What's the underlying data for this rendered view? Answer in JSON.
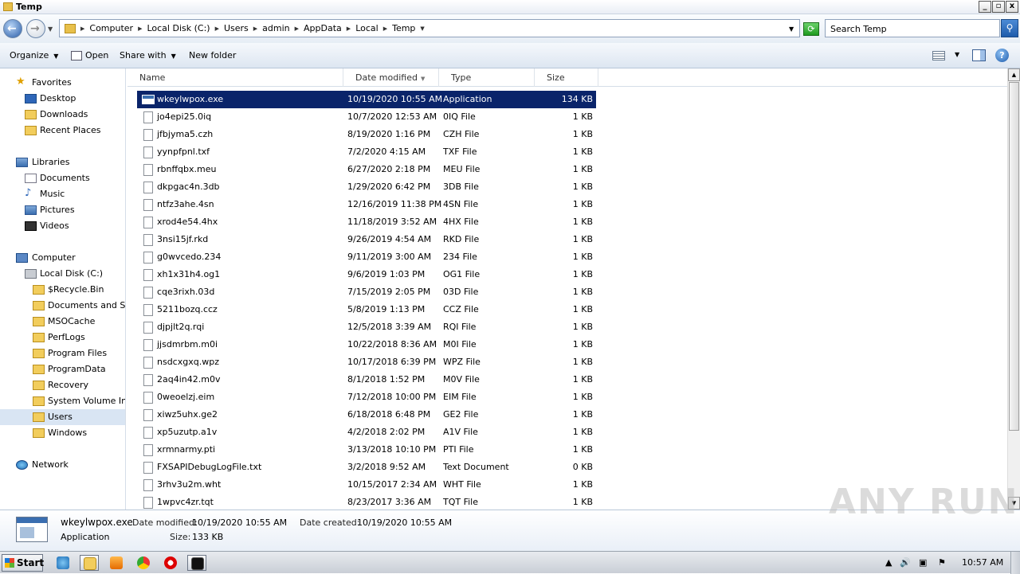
{
  "window": {
    "title": "Temp"
  },
  "address": {
    "crumbs": [
      "Computer",
      "Local Disk (C:)",
      "Users",
      "admin",
      "AppData",
      "Local",
      "Temp"
    ],
    "search_placeholder": "Search Temp"
  },
  "toolbar": {
    "organize": "Organize",
    "open": "Open",
    "share_with": "Share with",
    "new_folder": "New folder"
  },
  "nav": {
    "favorites": "Favorites",
    "desktop": "Desktop",
    "downloads": "Downloads",
    "recent": "Recent Places",
    "libraries": "Libraries",
    "documents": "Documents",
    "music": "Music",
    "pictures": "Pictures",
    "videos": "Videos",
    "computer": "Computer",
    "local_disk": "Local Disk (C:)",
    "folders": [
      "$Recycle.Bin",
      "Documents and Settings",
      "MSOCache",
      "PerfLogs",
      "Program Files",
      "ProgramData",
      "Recovery",
      "System Volume Information",
      "Users",
      "Windows"
    ],
    "network": "Network"
  },
  "columns": {
    "name": "Name",
    "date": "Date modified",
    "type": "Type",
    "size": "Size"
  },
  "files": [
    {
      "name": "wkeylwpox.exe",
      "date": "10/19/2020 10:55 AM",
      "type": "Application",
      "size": "134 KB"
    },
    {
      "name": "jo4epi25.0iq",
      "date": "10/7/2020 12:53 AM",
      "type": "0IQ File",
      "size": "1 KB"
    },
    {
      "name": "jfbjyma5.czh",
      "date": "8/19/2020 1:16 PM",
      "type": "CZH File",
      "size": "1 KB"
    },
    {
      "name": "yynpfpnl.txf",
      "date": "7/2/2020 4:15 AM",
      "type": "TXF File",
      "size": "1 KB"
    },
    {
      "name": "rbnffqbx.meu",
      "date": "6/27/2020 2:18 PM",
      "type": "MEU File",
      "size": "1 KB"
    },
    {
      "name": "dkpgac4n.3db",
      "date": "1/29/2020 6:42 PM",
      "type": "3DB File",
      "size": "1 KB"
    },
    {
      "name": "ntfz3ahe.4sn",
      "date": "12/16/2019 11:38 PM",
      "type": "4SN File",
      "size": "1 KB"
    },
    {
      "name": "xrod4e54.4hx",
      "date": "11/18/2019 3:52 AM",
      "type": "4HX File",
      "size": "1 KB"
    },
    {
      "name": "3nsi15jf.rkd",
      "date": "9/26/2019 4:54 AM",
      "type": "RKD File",
      "size": "1 KB"
    },
    {
      "name": "g0wvcedo.234",
      "date": "9/11/2019 3:00 AM",
      "type": "234 File",
      "size": "1 KB"
    },
    {
      "name": "xh1x31h4.og1",
      "date": "9/6/2019 1:03 PM",
      "type": "OG1 File",
      "size": "1 KB"
    },
    {
      "name": "cqe3rixh.03d",
      "date": "7/15/2019 2:05 PM",
      "type": "03D File",
      "size": "1 KB"
    },
    {
      "name": "5211bozq.ccz",
      "date": "5/8/2019 1:13 PM",
      "type": "CCZ File",
      "size": "1 KB"
    },
    {
      "name": "djpjlt2q.rqi",
      "date": "12/5/2018 3:39 AM",
      "type": "RQI File",
      "size": "1 KB"
    },
    {
      "name": "jjsdmrbm.m0i",
      "date": "10/22/2018 8:36 AM",
      "type": "M0I File",
      "size": "1 KB"
    },
    {
      "name": "nsdcxgxq.wpz",
      "date": "10/17/2018 6:39 PM",
      "type": "WPZ File",
      "size": "1 KB"
    },
    {
      "name": "2aq4in42.m0v",
      "date": "8/1/2018 1:52 PM",
      "type": "M0V File",
      "size": "1 KB"
    },
    {
      "name": "0weoelzj.eim",
      "date": "7/12/2018 10:00 PM",
      "type": "EIM File",
      "size": "1 KB"
    },
    {
      "name": "xiwz5uhx.ge2",
      "date": "6/18/2018 6:48 PM",
      "type": "GE2 File",
      "size": "1 KB"
    },
    {
      "name": "xp5uzutp.a1v",
      "date": "4/2/2018 2:02 PM",
      "type": "A1V File",
      "size": "1 KB"
    },
    {
      "name": "xrmnarmy.pti",
      "date": "3/13/2018 10:10 PM",
      "type": "PTI File",
      "size": "1 KB"
    },
    {
      "name": "FXSAPIDebugLogFile.txt",
      "date": "3/2/2018 9:52 AM",
      "type": "Text Document",
      "size": "0 KB"
    },
    {
      "name": "3rhv3u2m.wht",
      "date": "10/15/2017 2:34 AM",
      "type": "WHT File",
      "size": "1 KB"
    },
    {
      "name": "1wpvc4zr.tqt",
      "date": "8/23/2017 3:36 AM",
      "type": "TQT File",
      "size": "1 KB"
    }
  ],
  "details": {
    "name": "wkeylwpox.exe",
    "type": "Application",
    "modified_label": "Date modified:",
    "modified": "10/19/2020 10:55 AM",
    "created_label": "Date created:",
    "created": "10/19/2020 10:55 AM",
    "size_label": "Size:",
    "size": "133 KB"
  },
  "watermark": "ANY RUN",
  "taskbar": {
    "start": "Start",
    "clock": "10:57 AM"
  }
}
